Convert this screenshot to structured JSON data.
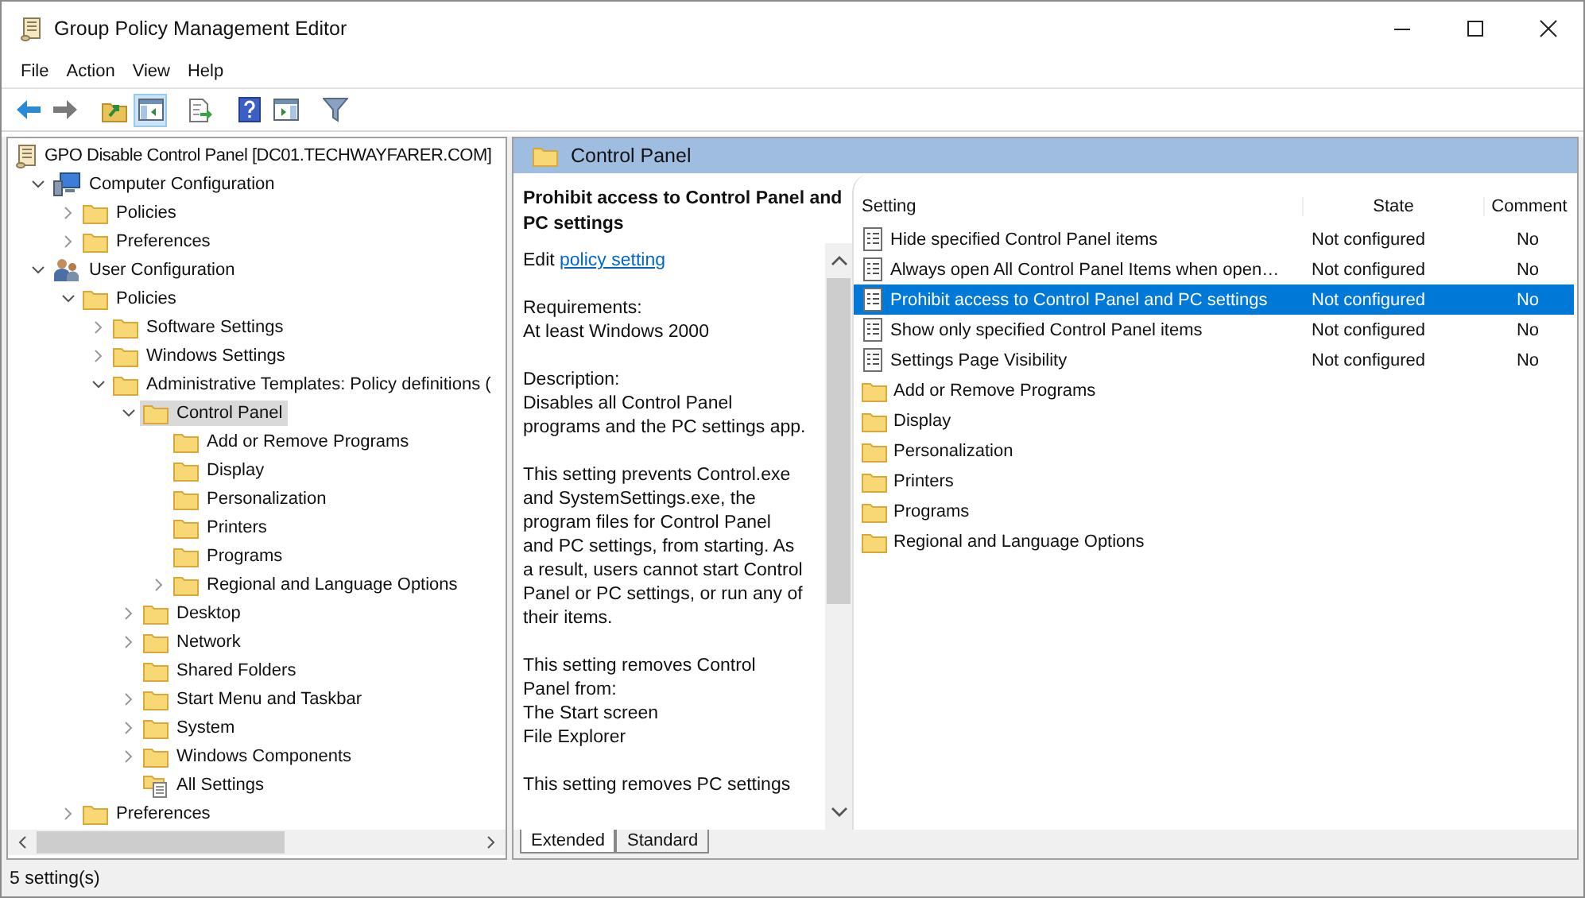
{
  "window": {
    "title": "Group Policy Management Editor"
  },
  "menu": [
    "File",
    "Action",
    "View",
    "Help"
  ],
  "toolbar": [
    {
      "kind": "back",
      "pressed": false
    },
    {
      "kind": "forward",
      "pressed": false
    },
    {
      "kind": "up",
      "pressed": false
    },
    {
      "kind": "tree-pane",
      "pressed": true
    },
    {
      "kind": "export",
      "pressed": false
    },
    {
      "kind": "help",
      "pressed": false
    },
    {
      "kind": "action-pane",
      "pressed": false
    },
    {
      "kind": "filter",
      "pressed": false
    }
  ],
  "tree": {
    "label": "GPO Disable Control Panel [DC01.TECHWAYFARER.COM]",
    "kind": "gpo",
    "selected": false,
    "children": [
      {
        "label": "Computer Configuration",
        "kind": "computer",
        "selected": false,
        "expanded": true,
        "children": [
          {
            "label": "Policies",
            "kind": "folder",
            "selected": false,
            "expanded": false
          },
          {
            "label": "Preferences",
            "kind": "folder",
            "selected": false,
            "expanded": false
          }
        ]
      },
      {
        "label": "User Configuration",
        "kind": "user",
        "selected": false,
        "expanded": true,
        "children": [
          {
            "label": "Policies",
            "kind": "folder",
            "selected": false,
            "expanded": true,
            "children": [
              {
                "label": "Software Settings",
                "kind": "folder",
                "selected": false,
                "expanded": false
              },
              {
                "label": "Windows Settings",
                "kind": "folder",
                "selected": false,
                "expanded": false
              },
              {
                "label": "Administrative Templates: Policy definitions (",
                "kind": "folder",
                "selected": false,
                "expanded": true,
                "children": [
                  {
                    "label": "Control Panel",
                    "kind": "folder",
                    "selected": true,
                    "expanded": true,
                    "children": [
                      {
                        "label": "Add or Remove Programs",
                        "kind": "folder",
                        "selected": false
                      },
                      {
                        "label": "Display",
                        "kind": "folder",
                        "selected": false
                      },
                      {
                        "label": "Personalization",
                        "kind": "folder",
                        "selected": false
                      },
                      {
                        "label": "Printers",
                        "kind": "folder",
                        "selected": false
                      },
                      {
                        "label": "Programs",
                        "kind": "folder",
                        "selected": false
                      },
                      {
                        "label": "Regional and Language Options",
                        "kind": "folder",
                        "selected": false,
                        "expanded": false
                      }
                    ]
                  },
                  {
                    "label": "Desktop",
                    "kind": "folder",
                    "selected": false,
                    "expanded": false
                  },
                  {
                    "label": "Network",
                    "kind": "folder",
                    "selected": false,
                    "expanded": false
                  },
                  {
                    "label": "Shared Folders",
                    "kind": "folder",
                    "selected": false
                  },
                  {
                    "label": "Start Menu and Taskbar",
                    "kind": "folder",
                    "selected": false,
                    "expanded": false
                  },
                  {
                    "label": "System",
                    "kind": "folder",
                    "selected": false,
                    "expanded": false
                  },
                  {
                    "label": "Windows Components",
                    "kind": "folder",
                    "selected": false,
                    "expanded": false
                  },
                  {
                    "label": "All Settings",
                    "kind": "all-settings",
                    "selected": false
                  }
                ]
              }
            ]
          },
          {
            "label": "Preferences",
            "kind": "folder",
            "selected": false,
            "expanded": false
          }
        ]
      }
    ]
  },
  "header": {
    "title": "Control Panel"
  },
  "details": {
    "title": "Prohibit access to Control Panel and PC settings",
    "edit_prefix": "Edit",
    "edit_link": "policy setting",
    "paragraphs": [
      "Requirements:\nAt least Windows 2000",
      "Description:\nDisables all Control Panel\nprograms and the PC settings app.",
      "This setting prevents Control.exe\nand SystemSettings.exe, the\nprogram files for Control Panel\nand PC settings, from starting. As\na result, users cannot start Control\nPanel or PC settings, or run any of\ntheir items.",
      "This setting removes Control\nPanel from:\nThe Start screen\nFile Explorer",
      "This setting removes PC settings"
    ]
  },
  "table": {
    "columns": [
      "Setting",
      "State",
      "Comment"
    ],
    "rows": [
      {
        "kind": "setting",
        "name": "Hide specified Control Panel items",
        "state": "Not configured",
        "comment": "No",
        "selected": false
      },
      {
        "kind": "setting",
        "name": "Always open All Control Panel Items when open…",
        "state": "Not configured",
        "comment": "No",
        "selected": false
      },
      {
        "kind": "setting",
        "name": "Prohibit access to Control Panel and PC settings",
        "state": "Not configured",
        "comment": "No",
        "selected": true
      },
      {
        "kind": "setting",
        "name": "Show only specified Control Panel items",
        "state": "Not configured",
        "comment": "No",
        "selected": false
      },
      {
        "kind": "setting",
        "name": "Settings Page Visibility",
        "state": "Not configured",
        "comment": "No",
        "selected": false
      },
      {
        "kind": "folder",
        "name": "Add or Remove Programs",
        "selected": false
      },
      {
        "kind": "folder",
        "name": "Display",
        "selected": false
      },
      {
        "kind": "folder",
        "name": "Personalization",
        "selected": false
      },
      {
        "kind": "folder",
        "name": "Printers",
        "selected": false
      },
      {
        "kind": "folder",
        "name": "Programs",
        "selected": false
      },
      {
        "kind": "folder",
        "name": "Regional and Language Options",
        "selected": false
      }
    ]
  },
  "view_tabs": [
    {
      "label": "Extended",
      "selected": true
    },
    {
      "label": "Standard",
      "selected": false
    }
  ],
  "status_bar": "5 setting(s)"
}
